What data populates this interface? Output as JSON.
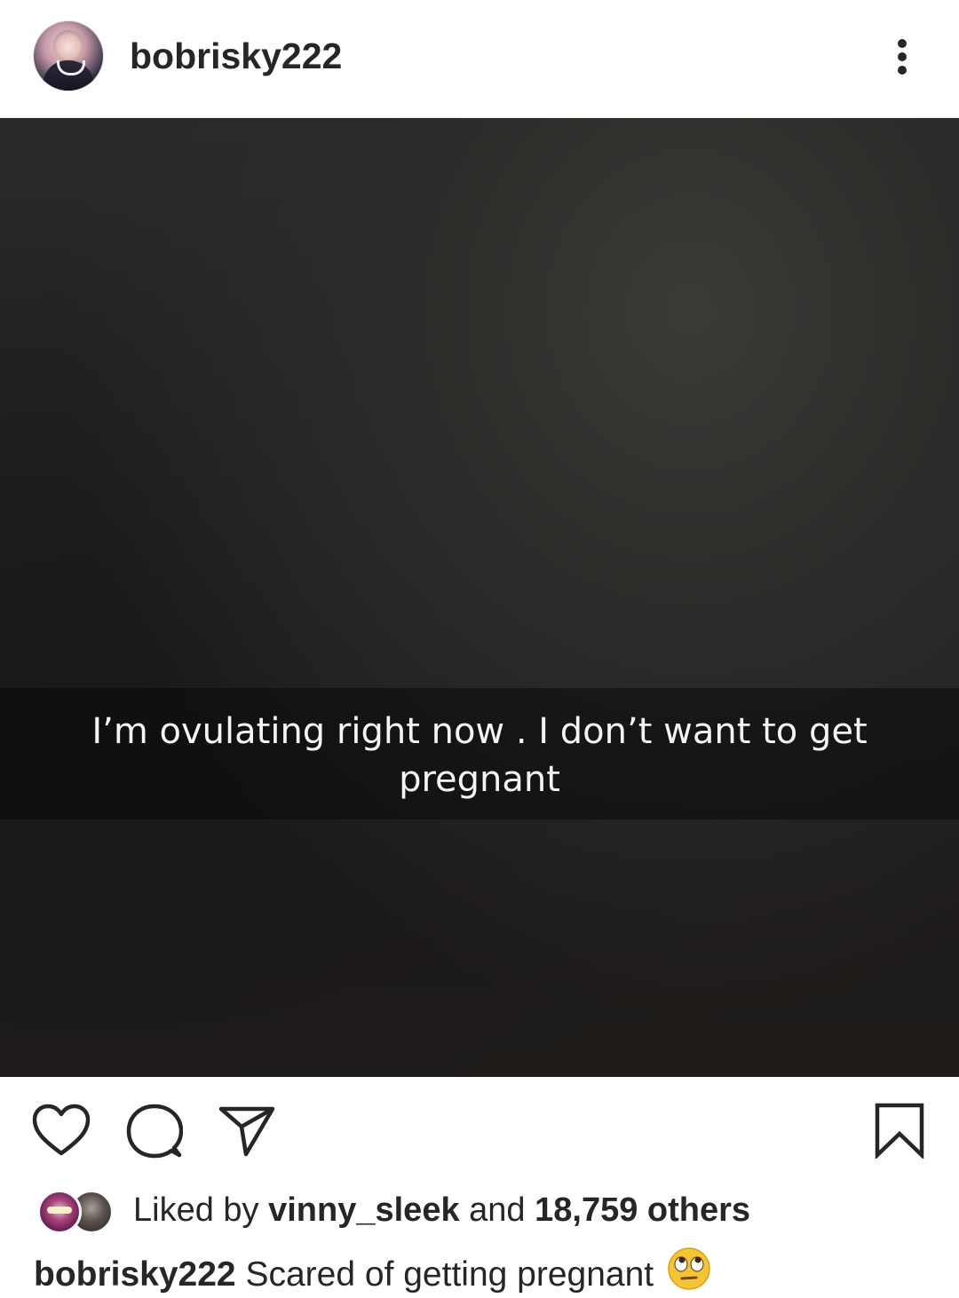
{
  "header": {
    "username": "bobrisky222",
    "menu_icon": "more-vertical-icon"
  },
  "post": {
    "overlay_text": "I’m ovulating right now . I don’t want to get pregnant"
  },
  "actions": {
    "like_icon": "heart-icon",
    "comment_icon": "comment-icon",
    "share_icon": "send-icon",
    "save_icon": "bookmark-icon"
  },
  "likes": {
    "prefix": "Liked by",
    "liker": "vinny_sleek",
    "connector": "and",
    "count_text": "18,759 others"
  },
  "caption": {
    "username": "bobrisky222",
    "text": "Scared of getting pregnant",
    "emoji": "eye-roll-emoji"
  }
}
